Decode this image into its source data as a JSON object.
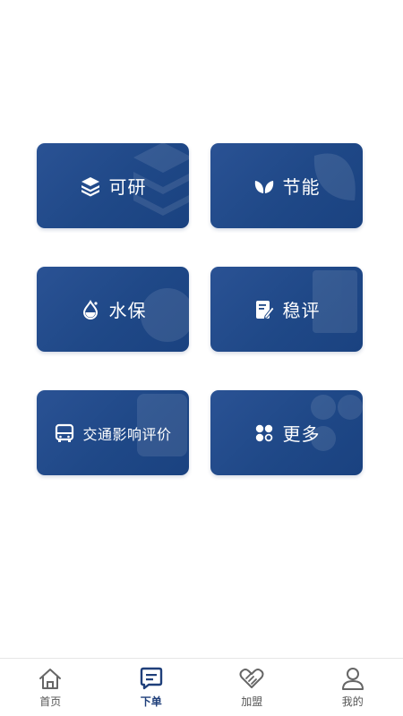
{
  "colors": {
    "card_bg": "#1f4887",
    "tab_active": "#1f3f7a",
    "tab_inactive": "#555555"
  },
  "cards": [
    {
      "label": "可研",
      "icon": "layers-icon"
    },
    {
      "label": "节能",
      "icon": "leaf-icon"
    },
    {
      "label": "水保",
      "icon": "water-drop-icon"
    },
    {
      "label": "稳评",
      "icon": "document-edit-icon"
    },
    {
      "label": "交通影响评价",
      "icon": "bus-icon"
    },
    {
      "label": "更多",
      "icon": "more-apps-icon"
    }
  ],
  "tabbar": {
    "items": [
      {
        "label": "首页",
        "icon": "home-icon",
        "active": false
      },
      {
        "label": "下单",
        "icon": "order-icon",
        "active": true
      },
      {
        "label": "加盟",
        "icon": "handshake-icon",
        "active": false
      },
      {
        "label": "我的",
        "icon": "user-icon",
        "active": false
      }
    ]
  }
}
